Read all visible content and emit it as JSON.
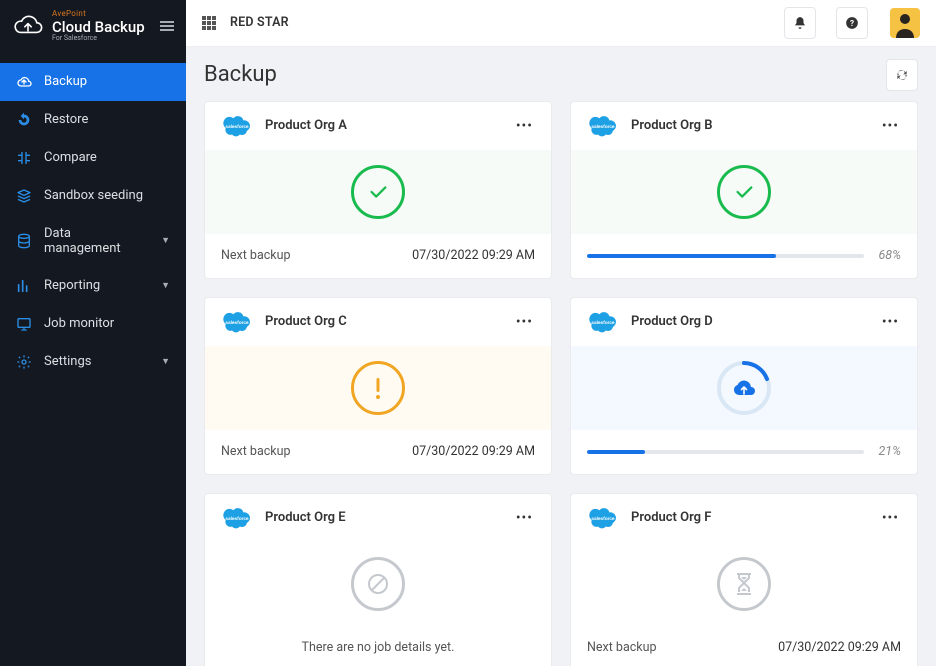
{
  "brand": {
    "vendor": "AvePoint",
    "product": "Cloud Backup",
    "subtitle": "For Salesforce"
  },
  "nav": {
    "items": [
      {
        "label": "Backup",
        "icon": "cloud-up-icon",
        "active": true
      },
      {
        "label": "Restore",
        "icon": "rewind-icon"
      },
      {
        "label": "Compare",
        "icon": "compare-icon"
      },
      {
        "label": "Sandbox seeding",
        "icon": "seeding-icon"
      },
      {
        "label": "Data management",
        "icon": "data-icon",
        "expandable": true
      },
      {
        "label": "Reporting",
        "icon": "report-icon",
        "expandable": true
      },
      {
        "label": "Job monitor",
        "icon": "monitor-icon"
      },
      {
        "label": "Settings",
        "icon": "gear-icon",
        "expandable": true
      }
    ]
  },
  "header": {
    "tenant": "RED STAR"
  },
  "page": {
    "title": "Backup"
  },
  "labels": {
    "next_backup": "Next backup",
    "no_details": "There are no job details yet."
  },
  "cards": [
    {
      "title": "Product Org A",
      "status": "success",
      "next_backup": "07/30/2022 09:29 AM"
    },
    {
      "title": "Product Org B",
      "status": "success",
      "progress": 68
    },
    {
      "title": "Product Org C",
      "status": "warning",
      "next_backup": "07/30/2022 09:29 AM"
    },
    {
      "title": "Product Org D",
      "status": "inprogress",
      "progress": 21
    },
    {
      "title": "Product Org E",
      "status": "none"
    },
    {
      "title": "Product Org F",
      "status": "pending",
      "next_backup": "07/30/2022 09:29 AM"
    }
  ]
}
